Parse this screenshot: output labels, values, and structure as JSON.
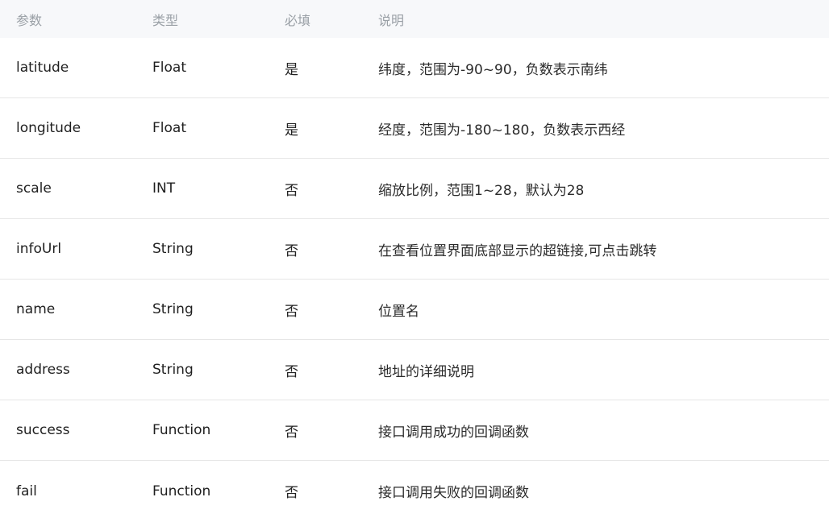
{
  "table": {
    "headers": {
      "param": "参数",
      "type": "类型",
      "required": "必填",
      "description": "说明"
    },
    "rows": [
      {
        "param": "latitude",
        "type": "Float",
        "required": "是",
        "description": "纬度，范围为-90~90，负数表示南纬"
      },
      {
        "param": "longitude",
        "type": "Float",
        "required": "是",
        "description": "经度，范围为-180~180，负数表示西经"
      },
      {
        "param": "scale",
        "type": "INT",
        "required": "否",
        "description": "缩放比例，范围1~28，默认为28"
      },
      {
        "param": "infoUrl",
        "type": "String",
        "required": "否",
        "description": "在查看位置界面底部显示的超链接,可点击跳转"
      },
      {
        "param": "name",
        "type": "String",
        "required": "否",
        "description": "位置名"
      },
      {
        "param": "address",
        "type": "String",
        "required": "否",
        "description": "地址的详细说明"
      },
      {
        "param": "success",
        "type": "Function",
        "required": "否",
        "description": "接口调用成功的回调函数"
      },
      {
        "param": "fail",
        "type": "Function",
        "required": "否",
        "description": "接口调用失败的回调函数"
      }
    ]
  }
}
